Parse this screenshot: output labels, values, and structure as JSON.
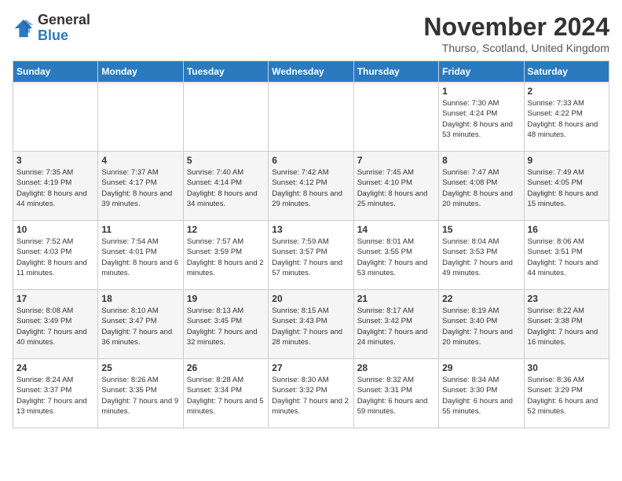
{
  "logo": {
    "general": "General",
    "blue": "Blue"
  },
  "header": {
    "month": "November 2024",
    "location": "Thurso, Scotland, United Kingdom"
  },
  "days_of_week": [
    "Sunday",
    "Monday",
    "Tuesday",
    "Wednesday",
    "Thursday",
    "Friday",
    "Saturday"
  ],
  "weeks": [
    [
      null,
      null,
      null,
      null,
      null,
      {
        "day": "1",
        "sunrise": "7:30 AM",
        "sunset": "4:24 PM",
        "daylight": "8 hours and 53 minutes."
      },
      {
        "day": "2",
        "sunrise": "7:33 AM",
        "sunset": "4:22 PM",
        "daylight": "8 hours and 48 minutes."
      }
    ],
    [
      {
        "day": "3",
        "sunrise": "7:35 AM",
        "sunset": "4:19 PM",
        "daylight": "8 hours and 44 minutes."
      },
      {
        "day": "4",
        "sunrise": "7:37 AM",
        "sunset": "4:17 PM",
        "daylight": "8 hours and 39 minutes."
      },
      {
        "day": "5",
        "sunrise": "7:40 AM",
        "sunset": "4:14 PM",
        "daylight": "8 hours and 34 minutes."
      },
      {
        "day": "6",
        "sunrise": "7:42 AM",
        "sunset": "4:12 PM",
        "daylight": "8 hours and 29 minutes."
      },
      {
        "day": "7",
        "sunrise": "7:45 AM",
        "sunset": "4:10 PM",
        "daylight": "8 hours and 25 minutes."
      },
      {
        "day": "8",
        "sunrise": "7:47 AM",
        "sunset": "4:08 PM",
        "daylight": "8 hours and 20 minutes."
      },
      {
        "day": "9",
        "sunrise": "7:49 AM",
        "sunset": "4:05 PM",
        "daylight": "8 hours and 15 minutes."
      }
    ],
    [
      {
        "day": "10",
        "sunrise": "7:52 AM",
        "sunset": "4:03 PM",
        "daylight": "8 hours and 11 minutes."
      },
      {
        "day": "11",
        "sunrise": "7:54 AM",
        "sunset": "4:01 PM",
        "daylight": "8 hours and 6 minutes."
      },
      {
        "day": "12",
        "sunrise": "7:57 AM",
        "sunset": "3:59 PM",
        "daylight": "8 hours and 2 minutes."
      },
      {
        "day": "13",
        "sunrise": "7:59 AM",
        "sunset": "3:57 PM",
        "daylight": "7 hours and 57 minutes."
      },
      {
        "day": "14",
        "sunrise": "8:01 AM",
        "sunset": "3:55 PM",
        "daylight": "7 hours and 53 minutes."
      },
      {
        "day": "15",
        "sunrise": "8:04 AM",
        "sunset": "3:53 PM",
        "daylight": "7 hours and 49 minutes."
      },
      {
        "day": "16",
        "sunrise": "8:06 AM",
        "sunset": "3:51 PM",
        "daylight": "7 hours and 44 minutes."
      }
    ],
    [
      {
        "day": "17",
        "sunrise": "8:08 AM",
        "sunset": "3:49 PM",
        "daylight": "7 hours and 40 minutes."
      },
      {
        "day": "18",
        "sunrise": "8:10 AM",
        "sunset": "3:47 PM",
        "daylight": "7 hours and 36 minutes."
      },
      {
        "day": "19",
        "sunrise": "8:13 AM",
        "sunset": "3:45 PM",
        "daylight": "7 hours and 32 minutes."
      },
      {
        "day": "20",
        "sunrise": "8:15 AM",
        "sunset": "3:43 PM",
        "daylight": "7 hours and 28 minutes."
      },
      {
        "day": "21",
        "sunrise": "8:17 AM",
        "sunset": "3:42 PM",
        "daylight": "7 hours and 24 minutes."
      },
      {
        "day": "22",
        "sunrise": "8:19 AM",
        "sunset": "3:40 PM",
        "daylight": "7 hours and 20 minutes."
      },
      {
        "day": "23",
        "sunrise": "8:22 AM",
        "sunset": "3:38 PM",
        "daylight": "7 hours and 16 minutes."
      }
    ],
    [
      {
        "day": "24",
        "sunrise": "8:24 AM",
        "sunset": "3:37 PM",
        "daylight": "7 hours and 13 minutes."
      },
      {
        "day": "25",
        "sunrise": "8:26 AM",
        "sunset": "3:35 PM",
        "daylight": "7 hours and 9 minutes."
      },
      {
        "day": "26",
        "sunrise": "8:28 AM",
        "sunset": "3:34 PM",
        "daylight": "7 hours and 5 minutes."
      },
      {
        "day": "27",
        "sunrise": "8:30 AM",
        "sunset": "3:32 PM",
        "daylight": "7 hours and 2 minutes."
      },
      {
        "day": "28",
        "sunrise": "8:32 AM",
        "sunset": "3:31 PM",
        "daylight": "6 hours and 59 minutes."
      },
      {
        "day": "29",
        "sunrise": "8:34 AM",
        "sunset": "3:30 PM",
        "daylight": "6 hours and 55 minutes."
      },
      {
        "day": "30",
        "sunrise": "8:36 AM",
        "sunset": "3:29 PM",
        "daylight": "6 hours and 52 minutes."
      }
    ]
  ],
  "labels": {
    "sunrise": "Sunrise:",
    "sunset": "Sunset:",
    "daylight": "Daylight:"
  }
}
